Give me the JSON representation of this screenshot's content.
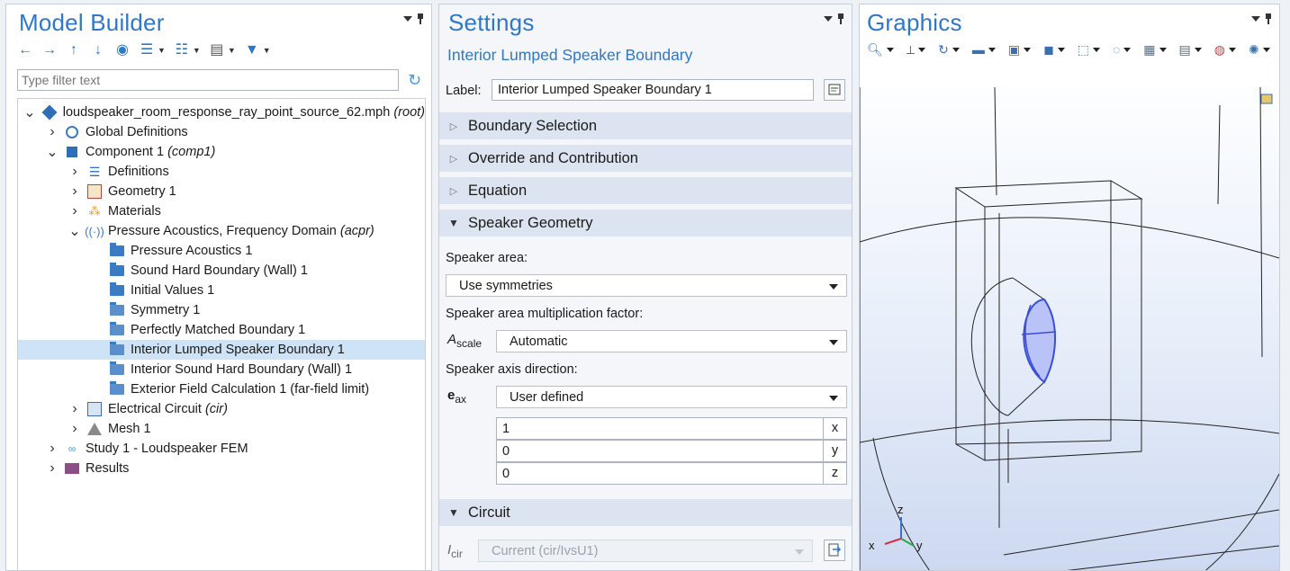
{
  "model_builder": {
    "title": "Model Builder",
    "toolbar_icons": [
      "arrow-left-icon",
      "arrow-right-icon",
      "arrow-up-icon",
      "arrow-down-icon",
      "show-icon",
      "collapse-icon",
      "expand-icon",
      "list-icon",
      "filter-icon"
    ],
    "filter_placeholder": "Type filter text",
    "tree": [
      {
        "name": "loudspeaker_room_response_ray_point_source_62.mph",
        "suffix": "(root)",
        "level": 0,
        "arrow": "v",
        "icon": "root-icon"
      },
      {
        "name": "Global Definitions",
        "suffix": "",
        "level": 1,
        "arrow": ">",
        "icon": "globe-icon"
      },
      {
        "name": "Component 1",
        "suffix": "(comp1)",
        "level": 1,
        "arrow": "v",
        "icon": "component-icon"
      },
      {
        "name": "Definitions",
        "suffix": "",
        "level": 2,
        "arrow": ">",
        "icon": "definitions-icon"
      },
      {
        "name": "Geometry 1",
        "suffix": "",
        "level": 2,
        "arrow": ">",
        "icon": "geometry-icon"
      },
      {
        "name": "Materials",
        "suffix": "",
        "level": 2,
        "arrow": ">",
        "icon": "materials-icon"
      },
      {
        "name": "Pressure Acoustics, Frequency Domain",
        "suffix": "(acpr)",
        "level": 2,
        "arrow": "v",
        "icon": "acoustics-icon"
      },
      {
        "name": "Pressure Acoustics 1",
        "suffix": "",
        "level": 3,
        "arrow": "",
        "icon": "feature-d-icon"
      },
      {
        "name": "Sound Hard Boundary (Wall) 1",
        "suffix": "",
        "level": 3,
        "arrow": "",
        "icon": "feature-d-icon"
      },
      {
        "name": "Initial Values 1",
        "suffix": "",
        "level": 3,
        "arrow": "",
        "icon": "feature-d-icon"
      },
      {
        "name": "Symmetry 1",
        "suffix": "",
        "level": 3,
        "arrow": "",
        "icon": "feature-icon"
      },
      {
        "name": "Perfectly Matched Boundary 1",
        "suffix": "",
        "level": 3,
        "arrow": "",
        "icon": "feature-icon"
      },
      {
        "name": "Interior Lumped Speaker Boundary 1",
        "suffix": "",
        "level": 3,
        "arrow": "",
        "icon": "feature-icon",
        "selected": true
      },
      {
        "name": "Interior Sound Hard Boundary (Wall) 1",
        "suffix": "",
        "level": 3,
        "arrow": "",
        "icon": "feature-icon"
      },
      {
        "name": "Exterior Field Calculation 1 (far-field limit)",
        "suffix": "",
        "level": 3,
        "arrow": "",
        "icon": "feature-icon"
      },
      {
        "name": "Electrical Circuit",
        "suffix": "(cir)",
        "level": 2,
        "arrow": ">",
        "icon": "circuit-icon"
      },
      {
        "name": "Mesh 1",
        "suffix": "",
        "level": 2,
        "arrow": ">",
        "icon": "mesh-icon"
      },
      {
        "name": "Study 1 - Loudspeaker FEM",
        "suffix": "",
        "level": 1,
        "arrow": ">",
        "icon": "study-icon"
      },
      {
        "name": "Results",
        "suffix": "",
        "level": 1,
        "arrow": ">",
        "icon": "results-icon"
      }
    ]
  },
  "settings": {
    "title": "Settings",
    "subtitle": "Interior Lumped Speaker Boundary",
    "label_caption": "Label:",
    "label_value": "Interior Lumped Speaker Boundary 1",
    "sections": {
      "boundary_selection": "Boundary Selection",
      "override": "Override and Contribution",
      "equation": "Equation",
      "speaker_geometry": "Speaker Geometry",
      "circuit": "Circuit"
    },
    "speaker_area_label": "Speaker area:",
    "speaker_area_value": "Use symmetries",
    "multiplication_label": "Speaker area multiplication factor:",
    "a_scale_symbol": "A",
    "a_scale_sub": "scale",
    "a_scale_value": "Automatic",
    "axis_label": "Speaker axis direction:",
    "e_ax_symbol": "e",
    "e_ax_sub": "ax",
    "e_ax_value": "User defined",
    "vector": [
      {
        "value": "1",
        "unit": "x"
      },
      {
        "value": "0",
        "unit": "y"
      },
      {
        "value": "0",
        "unit": "z"
      }
    ],
    "i_cir_symbol": "I",
    "i_cir_sub": "cir",
    "i_cir_value": "Current (cir/IvsU1)"
  },
  "graphics": {
    "title": "Graphics",
    "toolbar_icons": [
      "zoom-icon",
      "axis-icon",
      "rotate-icon",
      "view-icon",
      "camera-icon",
      "render-icon",
      "select-icon",
      "hide-icon",
      "transparency-icon",
      "grid-icon",
      "light-icon",
      "scene-icon"
    ],
    "axis_labels": {
      "x": "x",
      "y": "y",
      "z": "z"
    },
    "colors": {
      "highlight": "#5b6ee6",
      "highlight_fill": "#b9c3f7",
      "edge": "#1a1a1a"
    }
  }
}
